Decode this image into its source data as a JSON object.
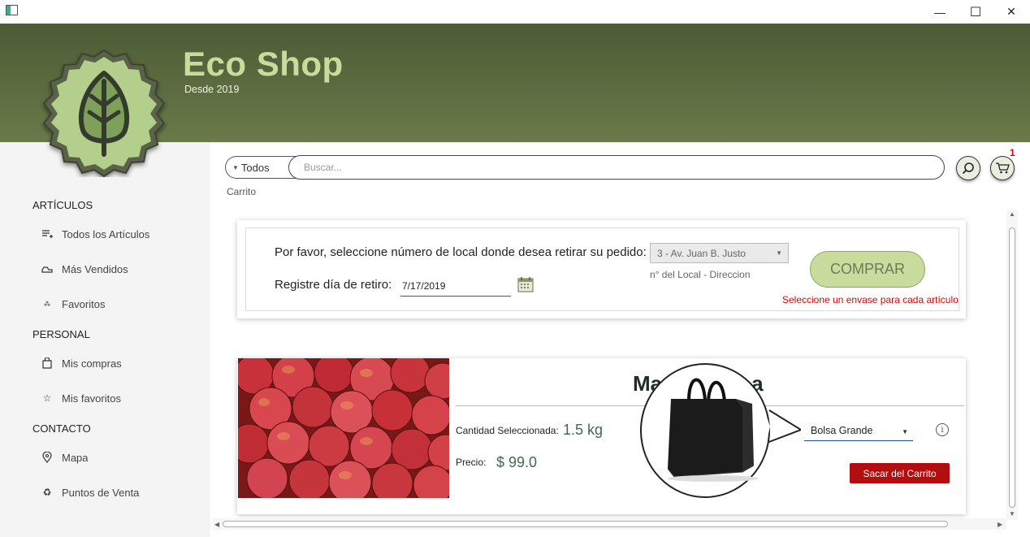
{
  "window": {
    "minimize": "—",
    "maximize": "☐",
    "close": "✕"
  },
  "header": {
    "title": "Eco Shop",
    "subtitle": "Desde 2019"
  },
  "sidebar": {
    "sections": [
      {
        "label": "ARTÍCULOS"
      },
      {
        "label": "PERSONAL"
      },
      {
        "label": "CONTACTO"
      }
    ],
    "items": [
      {
        "label": "Todos los Artículos",
        "icon": "list-add-icon"
      },
      {
        "label": "Más Vendidos",
        "icon": "hand-icon"
      },
      {
        "label": "Favoritos",
        "icon": "stars-icon"
      },
      {
        "label": "Mis compras",
        "icon": "bag-icon"
      },
      {
        "label": "Mis favoritos",
        "icon": "star-icon"
      },
      {
        "label": "Mapa",
        "icon": "map-pin-icon"
      },
      {
        "label": "Puntos de Venta",
        "icon": "recycle-icon"
      }
    ]
  },
  "search": {
    "filter_label": "Todos",
    "placeholder": "Buscar..."
  },
  "cart": {
    "badge_count": "1"
  },
  "breadcrumb": "Carrito",
  "checkout": {
    "local_prompt": "Por favor, seleccione número de local donde desea retirar su pedido:",
    "local_selected": "3 - Av. Juan B. Justo",
    "local_hint": "n° del Local - Direccion",
    "date_prompt": "Registre día de retiro:",
    "date_value": "7/17/2019",
    "buy_label": "COMPRAR",
    "warning": "Seleccione un envase para cada artículo"
  },
  "product": {
    "title_visible": "Ma",
    "title_tail": "a",
    "qty_label": "Cantidad Seleccionada:",
    "qty_value": "1.5 kg",
    "price_label": "Precio:",
    "price_value": "$ 99.0",
    "container_selected": "Bolsa Grande",
    "remove_label": "Sacar del Carrito"
  },
  "colors": {
    "header_dark": "#4c5b34",
    "brand_light": "#c9dc9e",
    "warning_red": "#e00000",
    "remove_red": "#b10f0f",
    "value_green": "#3f6b4c"
  }
}
